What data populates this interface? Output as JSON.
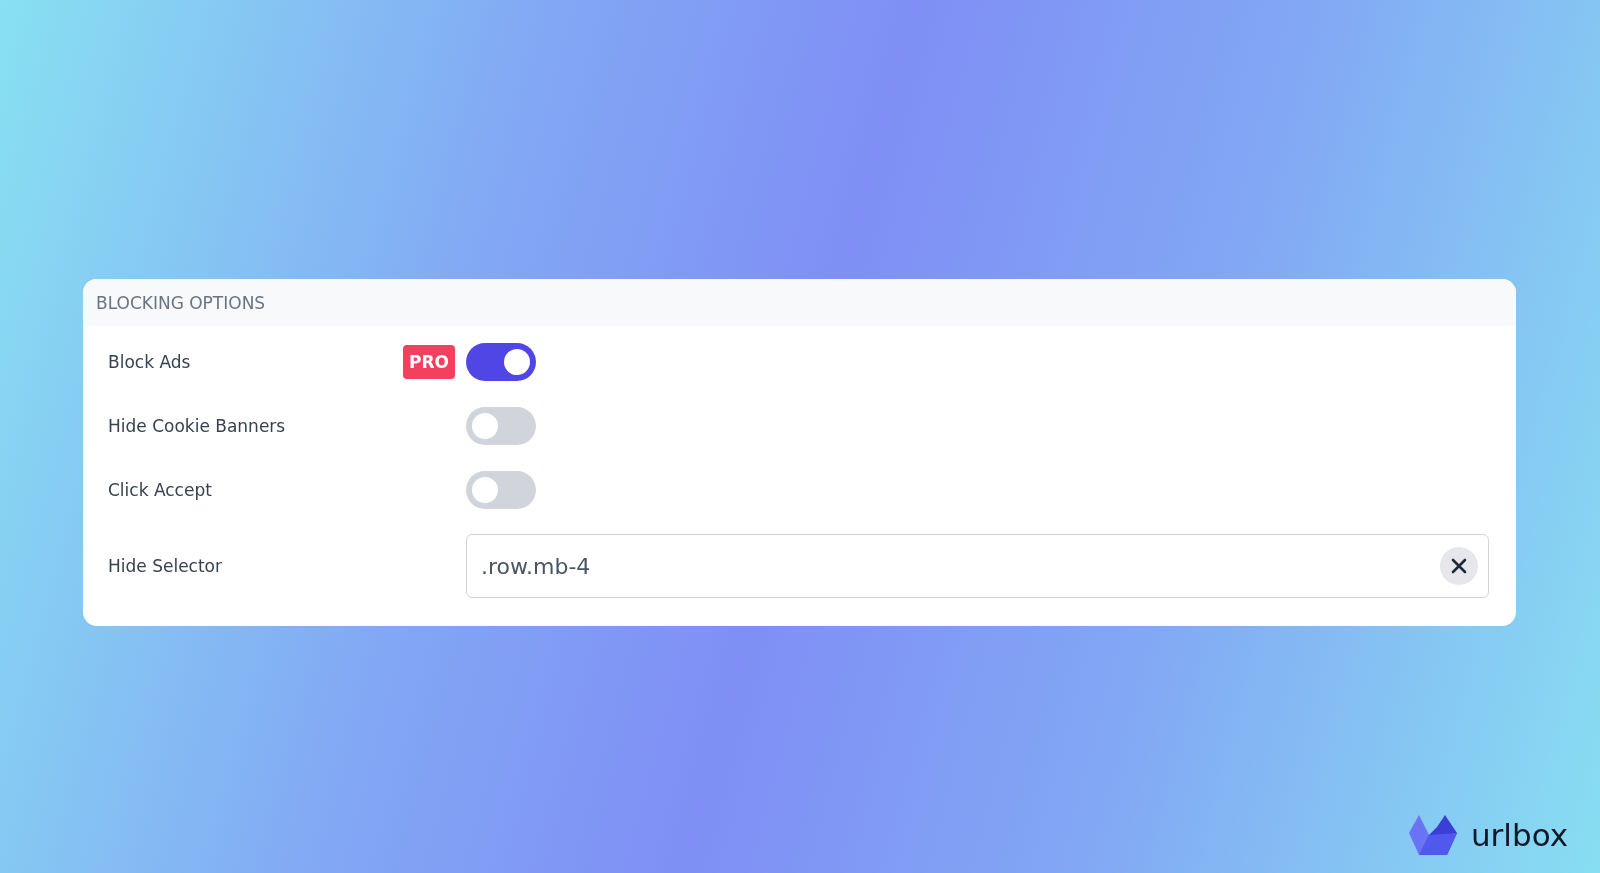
{
  "panel": {
    "title": "BLOCKING OPTIONS",
    "rows": [
      {
        "kind": "toggle",
        "label": "Block Ads",
        "badge": "PRO",
        "on": true
      },
      {
        "kind": "toggle",
        "label": "Hide Cookie Banners",
        "on": false
      },
      {
        "kind": "toggle",
        "label": "Click Accept",
        "on": false
      },
      {
        "kind": "text",
        "label": "Hide Selector",
        "value": ".row.mb-4"
      }
    ]
  },
  "logo": {
    "text": "urlbox"
  }
}
